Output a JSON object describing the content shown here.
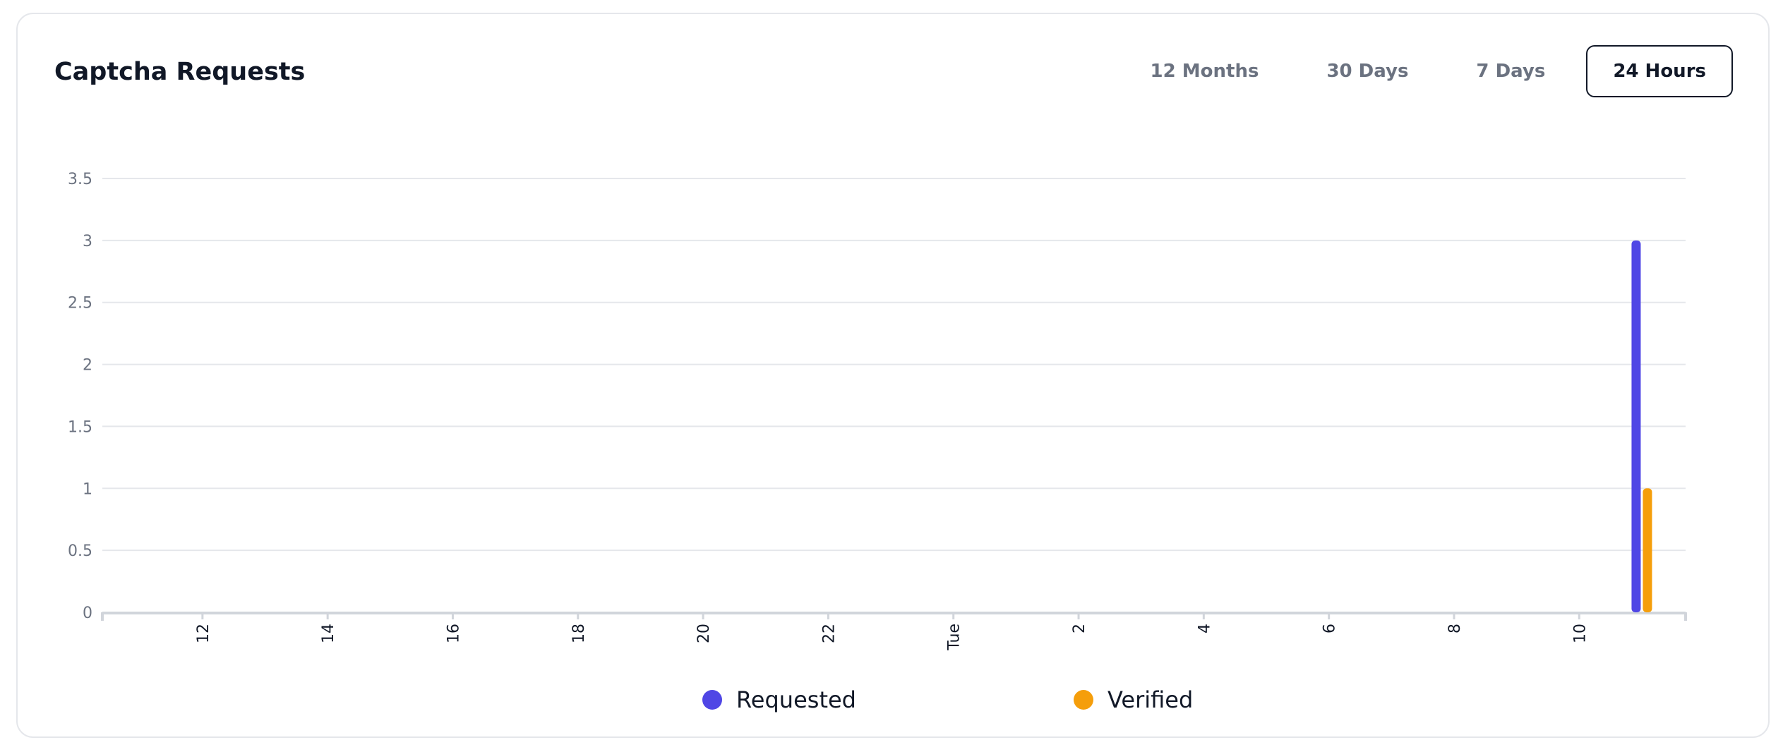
{
  "card": {
    "title": "Captcha Requests"
  },
  "range_tabs": [
    {
      "label": "12 Months",
      "active": false
    },
    {
      "label": "30 Days",
      "active": false
    },
    {
      "label": "7 Days",
      "active": false
    },
    {
      "label": "24 Hours",
      "active": true
    }
  ],
  "colors": {
    "requested": "#4f46e5",
    "verified": "#f59e0b",
    "grid": "#e5e7eb",
    "axis": "#d1d5db",
    "tick_text_y": "#6b7280",
    "tick_text_x": "#111827"
  },
  "chart_data": {
    "type": "bar",
    "title": "",
    "xlabel": "",
    "ylabel": "",
    "ylim": [
      0,
      3.5
    ],
    "yticks": [
      "0",
      "0.5",
      "1",
      "1.5",
      "2",
      "2.5",
      "3",
      "3.5"
    ],
    "x_tick_labels": [
      "12",
      "14",
      "16",
      "18",
      "20",
      "22",
      "Tue",
      "2",
      "4",
      "6",
      "8",
      "10"
    ],
    "x_tick_hours": [
      12,
      14,
      16,
      18,
      20,
      22,
      24,
      26,
      28,
      30,
      32,
      34
    ],
    "xlim_hours": [
      10.4,
      35.7
    ],
    "legend_position": "bottom",
    "grid": true,
    "series": [
      {
        "name": "Requested",
        "points": [
          {
            "hour": 35,
            "value": 3
          }
        ]
      },
      {
        "name": "Verified",
        "points": [
          {
            "hour": 35,
            "value": 1
          }
        ]
      }
    ]
  }
}
